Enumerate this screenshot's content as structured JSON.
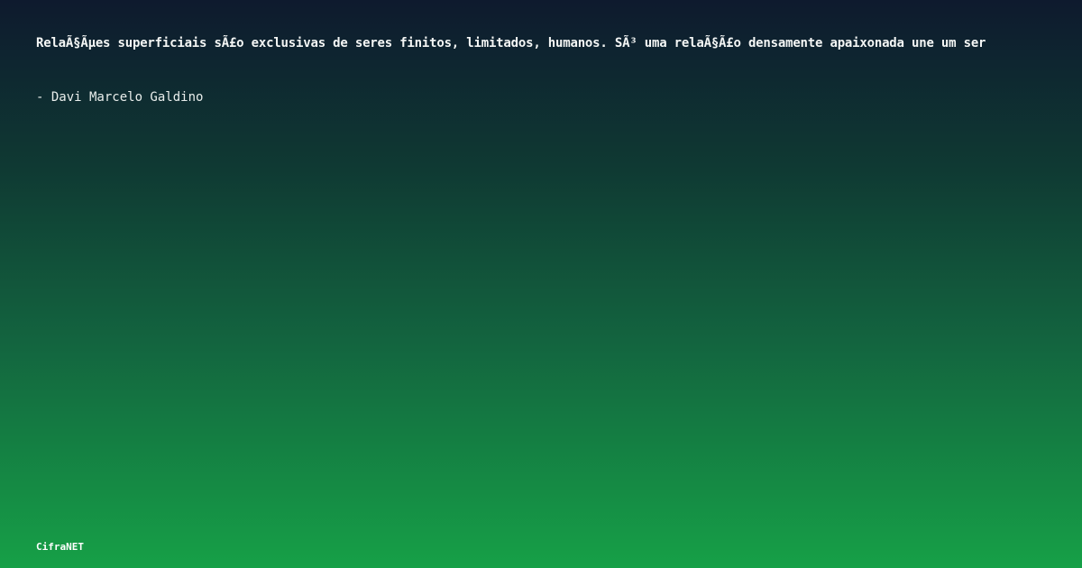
{
  "quote": {
    "text": "RelaÃ§Ãµes superficiais sÃ£o exclusivas de seres finitos, limitados, humanos. SÃ³ uma relaÃ§Ã£o densamente apaixonada une um ser"
  },
  "author": {
    "text": "- Davi Marcelo Galdino"
  },
  "brand": {
    "name": "CifraNET"
  }
}
